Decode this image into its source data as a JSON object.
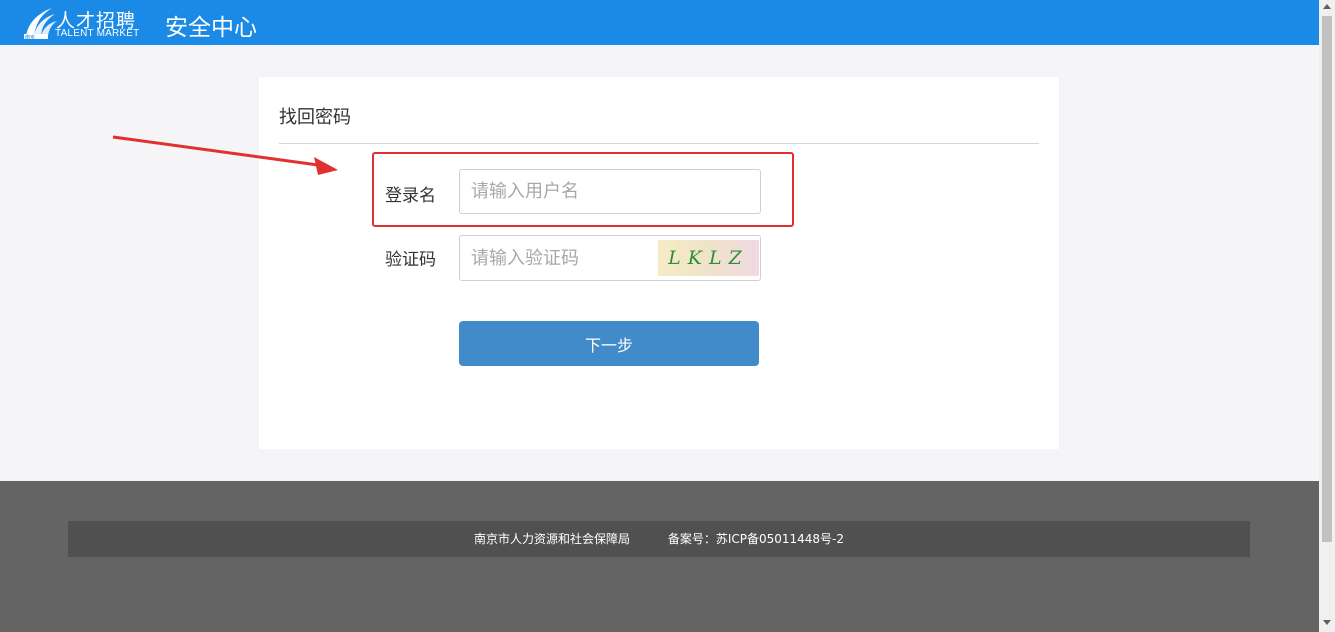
{
  "header": {
    "logo_cn": "人才招聘",
    "logo_en": "TALENT MARKET",
    "title": "安全中心",
    "logo_icon": "stylized-wave-logo-icon"
  },
  "card": {
    "title": "找回密码",
    "username_label": "登录名",
    "username_placeholder": "请输入用户名",
    "username_value": "",
    "captcha_label": "验证码",
    "captcha_placeholder": "请输入验证码",
    "captcha_value": "",
    "captcha_text": "LKLZ",
    "next_button": "下一步"
  },
  "footer": {
    "org": "南京市人力资源和社会保障局",
    "icp": "备案号：苏ICP备05011448号-2"
  },
  "colors": {
    "header_bg": "#1a8ae6",
    "button_bg": "#428bca",
    "footer_bg": "#646464",
    "highlight": "#e03030"
  }
}
